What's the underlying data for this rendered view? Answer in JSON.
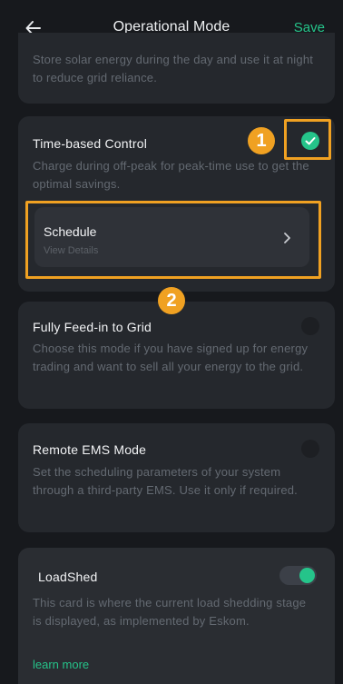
{
  "header": {
    "title": "Operational Mode",
    "save_label": "Save"
  },
  "modes": [
    {
      "title": "",
      "description": "Store solar energy during the day and use it at night to reduce grid reliance.",
      "selected": false
    },
    {
      "title": "Time-based Control",
      "description": "Charge during off-peak for peak-time use to get the optimal savings.",
      "selected": true,
      "schedule": {
        "title": "Schedule",
        "subtitle": "View Details"
      }
    },
    {
      "title": "Fully Feed-in to Grid",
      "description": "Choose this mode if you have signed up for energy trading and want to sell all your energy to the grid.",
      "selected": false
    },
    {
      "title": "Remote EMS Mode",
      "description": "Set the scheduling parameters of your system through a third-party EMS. Use it only if required.",
      "selected": false
    }
  ],
  "loadshed": {
    "title": "LoadShed",
    "description": "This card is where the current load shedding stage is displayed, as implemented by Eskom.",
    "link": "learn more",
    "enabled": true
  },
  "annotations": {
    "badge_1": "1",
    "badge_2": "2"
  },
  "colors": {
    "accent": "#25c48a",
    "highlight": "#f0a122",
    "card": "#25282d",
    "background": "#17191d"
  }
}
